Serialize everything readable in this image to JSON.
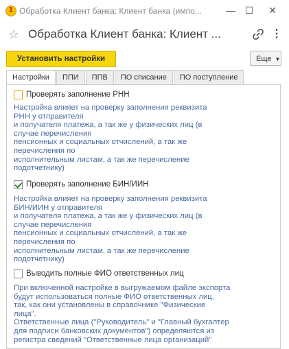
{
  "window": {
    "title": "Обработка Клиент банка: Клиент банка (импо..."
  },
  "header": {
    "title": "Обработка Клиент банка: Клиент ..."
  },
  "toolbar": {
    "apply_label": "Установить настройки",
    "more_label": "Еще"
  },
  "tabs": [
    {
      "label": "Настройки"
    },
    {
      "label": "ППИ"
    },
    {
      "label": "ППВ"
    },
    {
      "label": "ПО списание"
    },
    {
      "label": "ПО поступление"
    }
  ],
  "settings": [
    {
      "label": "Проверять заполнение РНН",
      "checked": false,
      "description": "Настройка влияет на проверку заполнения реквизита\nРНН у отправителя\nи получателя платежа, а так же у физических лиц (в\nслучае перечисления\nпенсионных и социальных отчислений, а так же\nперечисления по\nисполнительным листам, а так же перечисление\nподотчетнику)"
    },
    {
      "label": "Проверять заполнение БИН/ИИН",
      "checked": true,
      "description": "Настройка влияет на проверку заполнения реквизита\nБИН/ИИН у отправителя\nи получателя платежа, а так же у физических лиц (в\nслучае перечисления\nпенсионных и социальных отчислений, а так же\nперечисления по\nисполнительным листам, а так же перечисление\nподотчетнику)"
    },
    {
      "label": "Выводить полные ФИО ответственных лиц",
      "checked": false,
      "description": "При включенной настройке в выгружаемом файле экспорта\nбудут использоваться полные ФИО ответственных лиц,\nтак, как они установлены в справочнике \"Физические\nлица\".\nОтветственные лица (\"Руководитель\" и \"Главный бухгалтер\nдля подписи банковских документов\") определяются из\nрегистра сведений \"Ответственные лица организаций\""
    }
  ]
}
